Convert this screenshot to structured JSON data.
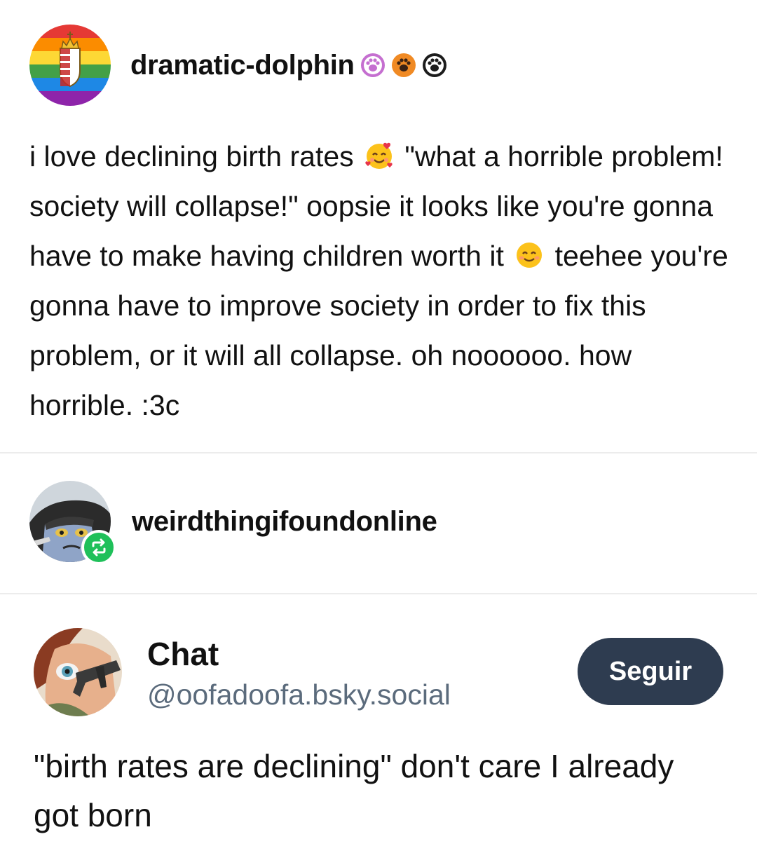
{
  "post": {
    "username": "dramatic-dolphin",
    "badges": [
      {
        "icon": "paw-badge-pink",
        "color": "#c56fd0"
      },
      {
        "icon": "paw-badge-orange",
        "color": "#f08a24"
      },
      {
        "icon": "paw-badge-black",
        "color": "#1c1c1c"
      }
    ],
    "text_1": "i love declining birth rates",
    "emoji_1": "smiling-face-with-hearts-emoji",
    "text_2": "\"what a horrible problem! society will collapse!\" oopsie it looks like you're gonna have to make having children worth it",
    "emoji_2": "smiling-face-emoji",
    "text_3": "teehee you're gonna have to improve society in order to fix this problem, or it will all collapse. oh noooooo. how horrible. :3c"
  },
  "reblog": {
    "username": "weirdthingifoundonline",
    "icon": "reblog-icon",
    "badge_color": "#1fc05a"
  },
  "bsky": {
    "display_name": "Chat",
    "handle": "@oofadoofa.bsky.social",
    "follow_label": "Seguir",
    "follow_color": "#2e3c50",
    "text": "\"birth rates are declining\" don't care I already got born"
  }
}
